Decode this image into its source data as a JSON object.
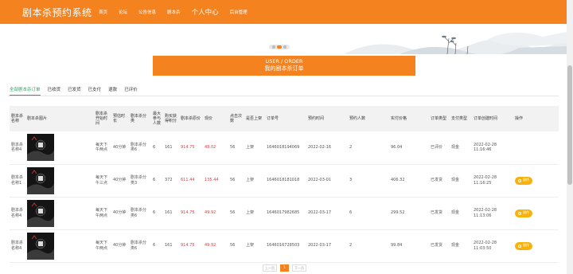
{
  "header": {
    "brand": "剧本杀预约系统",
    "nav": [
      "首页",
      "论坛",
      "公告信息",
      "剧本杀",
      "个人中心",
      "后台管理"
    ]
  },
  "banner": {
    "dots": 3,
    "active_dot": 1
  },
  "title": {
    "en": "USER / ORDER",
    "cn": "我的剧本杀订单"
  },
  "tabs": [
    "全部剧本杀订单",
    "已收货",
    "已发货",
    "已支付",
    "退款",
    "已评价"
  ],
  "table": {
    "headers": [
      "剧本杀名称",
      "剧本杀图片",
      "剧本杀开始时间",
      "预估时长",
      "剧本杀分类",
      "最大参与人数",
      "购买获得积分",
      "剧本杀原价",
      "现价",
      "点击次数",
      "是否上架",
      "订单号",
      "预约时间",
      "预约人数",
      "实付价格",
      "订单类型",
      "支付类型",
      "订单创建时间",
      "操作"
    ],
    "rows": [
      [
        "剧本杀名称4",
        "",
        "每天下午两点",
        "40分钟",
        "剧本杀分类6",
        "6",
        "161",
        "914.75",
        "48.02",
        "56",
        "上架",
        "1646018194069",
        "2022-02-16",
        "2",
        "96.04",
        "已评价",
        "现金",
        "2022-02-28 11:16:46",
        ""
      ],
      [
        "剧本杀名称1",
        "",
        "每天下午三点",
        "40分钟",
        "剧本杀分类3",
        "6",
        "372",
        "611.44",
        "135.44",
        "56",
        "上架",
        "1646018181018",
        "2022-03-01",
        "3",
        "406.32",
        "已发货",
        "现金",
        "2022-02-28 11:16:25",
        "操作"
      ],
      [
        "剧本杀名称4",
        "",
        "每天下午两点",
        "40分钟",
        "剧本杀分类6",
        "6",
        "161",
        "914.75",
        "49.92",
        "56",
        "上架",
        "1646017982685",
        "2022-03-17",
        "6",
        "299.52",
        "已发货",
        "现金",
        "2022-02-28 11:13:06",
        "操作"
      ],
      [
        "剧本杀名称4",
        "",
        "每天下午两点",
        "40分钟",
        "剧本杀分类6",
        "6",
        "161",
        "914.75",
        "49.92",
        "56",
        "上架",
        "1646016728503",
        "2022-03-17",
        "2",
        "99.84",
        "已发货",
        "现金",
        "2022-02-28 11:03:50",
        "操作"
      ]
    ]
  },
  "pagination": {
    "prev": "上一页",
    "current": "1",
    "next": "下一页"
  },
  "colors": {
    "accent": "#f4831f",
    "tab_active": "#2da462",
    "button": "#f6b10c",
    "price": "#e63b3b"
  }
}
